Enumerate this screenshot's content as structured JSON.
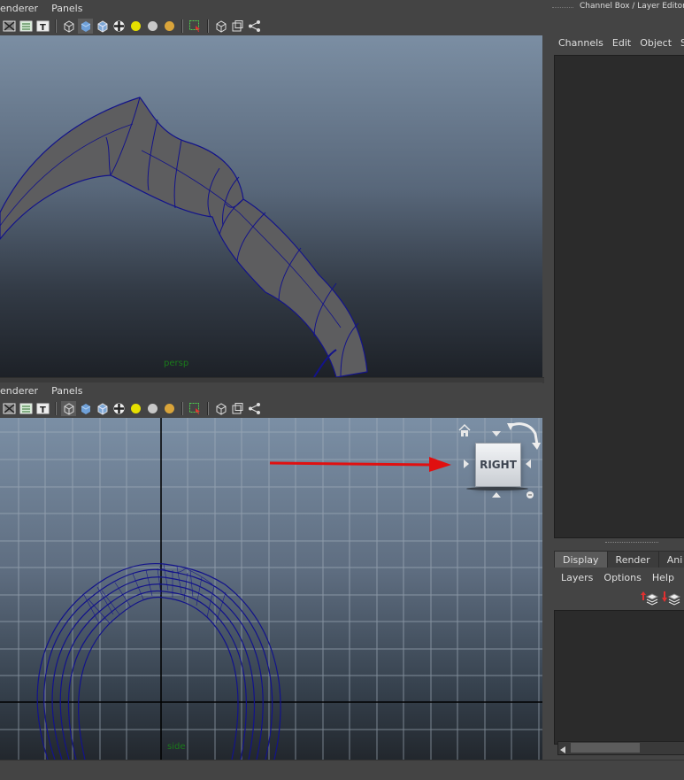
{
  "top_viewport": {
    "menu": [
      "enderer",
      "Panels"
    ],
    "camera_label": "persp"
  },
  "bottom_viewport": {
    "menu": [
      "enderer",
      "Panels"
    ],
    "camera_label": "side",
    "viewcube_label": "RIGHT"
  },
  "toolbar_icons": [
    "xray-icon",
    "wireframe-on-shaded-icon",
    "texture-icon",
    "wireframe-cube-icon",
    "smooth-shade-icon",
    "flat-shade-icon",
    "checker-icon",
    "default-light-icon",
    "all-lights-icon",
    "shadow-light-icon",
    "select-icon",
    "isolate-icon",
    "resolution-gate-icon",
    "share-icon"
  ],
  "right_panel": {
    "title": "Channel Box / Layer Editor",
    "menu": [
      "Channels",
      "Edit",
      "Object",
      "S"
    ],
    "tabs": [
      "Display",
      "Render",
      "Ani"
    ],
    "layer_menu": [
      "Layers",
      "Options",
      "Help"
    ]
  },
  "colors": {
    "accent_wire": "#13138a",
    "arrow": "#e01010"
  }
}
